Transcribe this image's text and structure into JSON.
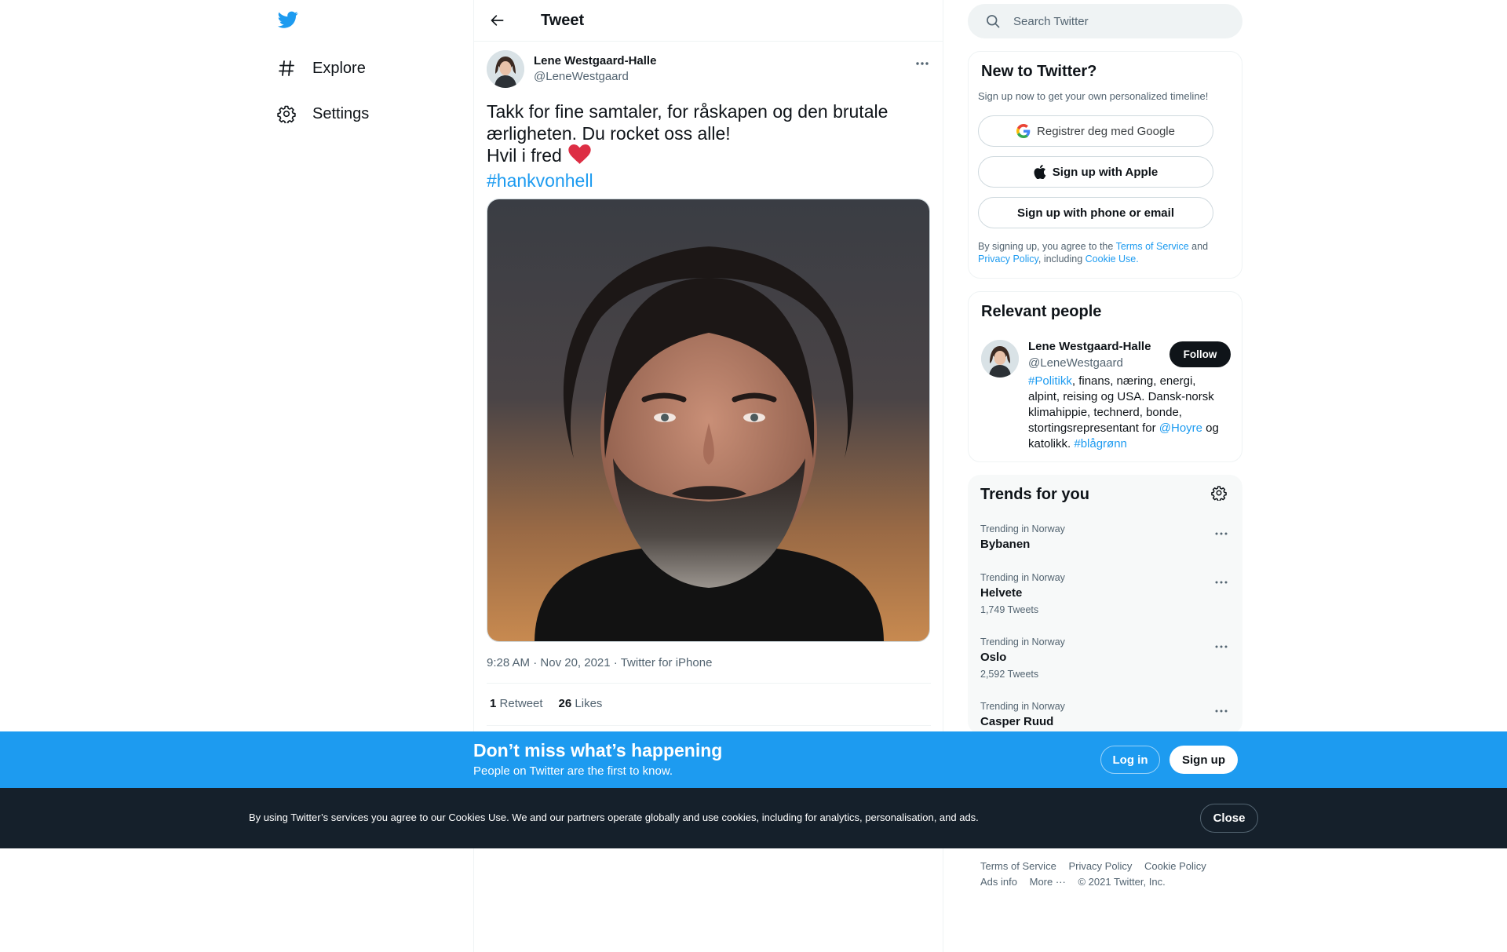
{
  "nav": {
    "logo_icon": "twitter-bird-icon",
    "items": [
      {
        "label": "Explore",
        "icon": "hashtag-icon"
      },
      {
        "label": "Settings",
        "icon": "gear-icon"
      }
    ]
  },
  "header": {
    "title": "Tweet",
    "back_icon": "arrow-left-icon"
  },
  "tweet": {
    "author_name": "Lene Westgaard-Halle",
    "author_handle": "@LeneWestgaard",
    "text_line1": "Takk for fine samtaler, for råskapen og den brutale",
    "text_line2": "ærligheten. Du rocket oss alle!",
    "text_line3": "Hvil i fred",
    "hashtag": "#hankvonhell",
    "time": "9:28 AM",
    "date": "Nov 20, 2021",
    "source": "Twitter for iPhone",
    "retweets_count": "1",
    "retweets_label": "Retweet",
    "likes_count": "26",
    "likes_label": "Likes"
  },
  "search": {
    "placeholder": "Search Twitter"
  },
  "new_to_twitter": {
    "title": "New to Twitter?",
    "subtitle": "Sign up now to get your own personalized timeline!",
    "google_label": "Registrer deg med Google",
    "apple_label": "Sign up with Apple",
    "phone_label": "Sign up with phone or email",
    "terms_prefix": "By signing up, you agree to the ",
    "terms_link": "Terms of Service",
    "terms_and": " and ",
    "privacy_link": "Privacy Policy",
    "terms_including": ", including ",
    "cookie_link": "Cookie Use."
  },
  "relevant_people": {
    "title": "Relevant people",
    "name": "Lene Westgaard-Halle",
    "handle": "@LeneWestgaard",
    "follow_label": "Follow",
    "bio_tag1": "#Politikk",
    "bio_part1": ", finans, næring, energi, alpint, reising og USA. Dansk-norsk klimahippie, technerd, bonde, stortingsrepresentant for ",
    "bio_mention": "@Hoyre",
    "bio_part2": " og katolikk. ",
    "bio_tag2": "#blågrønn"
  },
  "trends": {
    "title": "Trends for you",
    "items": [
      {
        "context": "Trending in Norway",
        "name": "Bybanen",
        "count": ""
      },
      {
        "context": "Trending in Norway",
        "name": "Helvete",
        "count": "1,749 Tweets"
      },
      {
        "context": "Trending in Norway",
        "name": "Oslo",
        "count": "2,592 Tweets"
      },
      {
        "context": "Trending in Norway",
        "name": "Casper Ruud",
        "count": ""
      }
    ]
  },
  "footer": {
    "terms": "Terms of Service",
    "privacy": "Privacy Policy",
    "cookie": "Cookie Policy",
    "ads": "Ads info",
    "more": "More ···",
    "copyright": "© 2021 Twitter, Inc."
  },
  "signup_banner": {
    "title": "Don’t miss what’s happening",
    "subtitle": "People on Twitter are the first to know.",
    "login_label": "Log in",
    "signup_label": "Sign up"
  },
  "cookie_banner": {
    "text_prefix": "By using Twitter’s services you agree to our ",
    "cookies_link": "Cookies Use",
    "text_suffix": ". We and our partners operate globally and use cookies, including for analytics, personalisation, and ads.",
    "close_label": "Close"
  },
  "colors": {
    "accent": "#1d9bf0",
    "text": "#0f1419",
    "secondary": "#536471",
    "cookie_bg": "#15202b"
  }
}
